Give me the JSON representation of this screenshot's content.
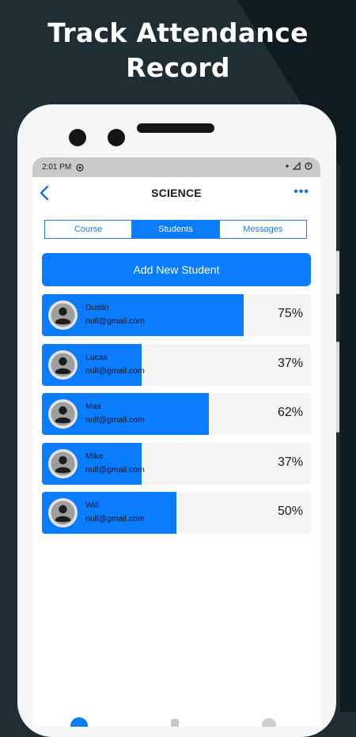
{
  "headline": {
    "line1": "Track Attendance",
    "line2": "Record"
  },
  "status_bar": {
    "time": "2:01 PM"
  },
  "app_bar": {
    "title": "SCIENCE",
    "more_label": "•••"
  },
  "tabs": [
    {
      "label": "Course",
      "active": false
    },
    {
      "label": "Students",
      "active": true
    },
    {
      "label": "Messages",
      "active": false
    }
  ],
  "add_button_label": "Add New Student",
  "students": [
    {
      "name": "Dustin",
      "email": "null@gmail.com",
      "attendance": 0.75,
      "attendance_label": "75%"
    },
    {
      "name": "Lucas",
      "email": "null@gmail.com",
      "attendance": 0.37,
      "attendance_label": "37%"
    },
    {
      "name": "Max",
      "email": "null@gmail.com",
      "attendance": 0.62,
      "attendance_label": "62%"
    },
    {
      "name": "Mike",
      "email": "null@gmail.com",
      "attendance": 0.37,
      "attendance_label": "37%"
    },
    {
      "name": "Will",
      "email": "null@gmail.com",
      "attendance": 0.5,
      "attendance_label": "50%"
    }
  ],
  "colors": {
    "accent": "#0a7cff",
    "background_dark": "#1f2e33",
    "background_darker": "#0f1b1f"
  },
  "icons": {
    "back": "chevron-left-icon",
    "more": "more-horizontal-icon",
    "avatar": "user-avatar-icon",
    "nav_home": "add-circle-icon",
    "nav_attendance": "clipboard-icon",
    "nav_profile": "user-icon"
  }
}
